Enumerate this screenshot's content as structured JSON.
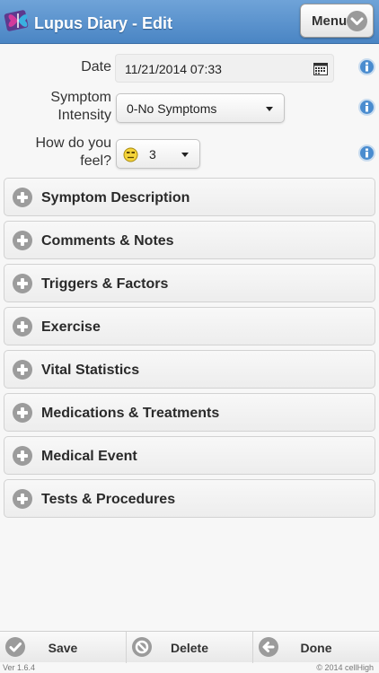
{
  "header": {
    "title": "Lupus Diary - Edit",
    "menu_label": "Menu",
    "app_icon": "butterfly-icon"
  },
  "form": {
    "date_label": "Date",
    "date_value": "11/21/2014 07:33",
    "intensity_label_1": "Symptom",
    "intensity_label_2": "Intensity",
    "intensity_value": "0-No Symptoms",
    "feel_label_1": "How do you",
    "feel_label_2": "feel?",
    "feel_value": "3",
    "feel_icon": "smiley-icon"
  },
  "sections": [
    "Symptom Description",
    "Comments & Notes",
    "Triggers & Factors",
    "Exercise",
    "Vital Statistics",
    "Medications & Treatments",
    "Medical Event",
    "Tests & Procedures"
  ],
  "footer": {
    "save_label": "Save",
    "delete_label": "Delete",
    "done_label": "Done",
    "version": "Ver 1.6.4",
    "copyright": "© 2014 cellHigh"
  },
  "colors": {
    "header": "#5b95d0",
    "info": "#4a8ccf",
    "icon_gray": "#9c9c9c"
  }
}
